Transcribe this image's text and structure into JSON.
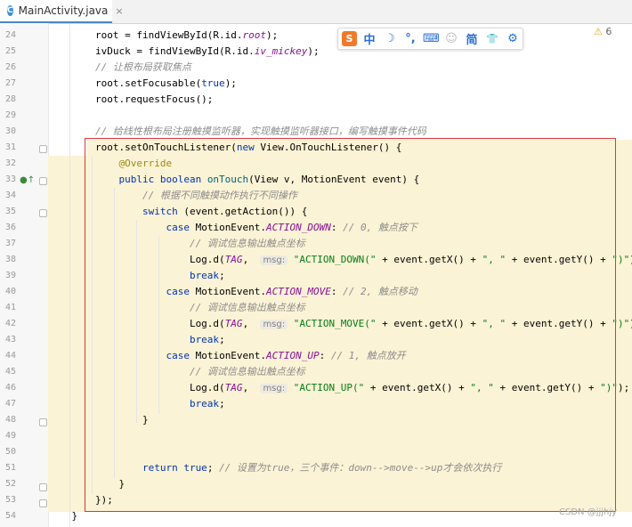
{
  "tab": {
    "icon": "C",
    "title": "MainActivity.java",
    "close": "×"
  },
  "warnings": {
    "icon": "warning-triangle-icon",
    "count": "6"
  },
  "ime_toolbar": {
    "logo": "S",
    "mode": "中",
    "items": [
      "☽",
      "°,",
      "⌨",
      "☺",
      "简",
      "👕",
      "⚙"
    ]
  },
  "lines": [
    {
      "n": "24",
      "segs": [
        [
          "",
          "        root = findViewById(R.id."
        ],
        [
          "field",
          "root"
        ],
        [
          "",
          ");"
        ]
      ]
    },
    {
      "n": "25",
      "segs": [
        [
          "",
          "        ivDuck = findViewById(R.id."
        ],
        [
          "field",
          "iv_mickey"
        ],
        [
          "",
          ");"
        ]
      ]
    },
    {
      "n": "26",
      "segs": [
        [
          "cm",
          "        // 让根布局获取焦点"
        ]
      ]
    },
    {
      "n": "27",
      "segs": [
        [
          "",
          "        root.setFocusable("
        ],
        [
          "kw",
          "true"
        ],
        [
          "",
          ");"
        ]
      ]
    },
    {
      "n": "28",
      "segs": [
        [
          "",
          "        root.requestFocus();"
        ]
      ]
    },
    {
      "n": "29",
      "segs": [
        [
          "",
          ""
        ]
      ]
    },
    {
      "n": "30",
      "segs": [
        [
          "cm",
          "        // 给线性根布局注册触摸监听器，实现触摸监听器接口，编写触摸事件代码"
        ]
      ]
    },
    {
      "n": "31",
      "segs": [
        [
          "",
          "        root.setOnTouchListener("
        ],
        [
          "kw",
          "new"
        ],
        [
          "",
          " View.OnTouchListener() {"
        ]
      ]
    },
    {
      "n": "32",
      "segs": [
        [
          "ann",
          "            @Override"
        ]
      ]
    },
    {
      "n": "33",
      "segs": [
        [
          "kw",
          "            public boolean "
        ],
        [
          "fn",
          "onTouch"
        ],
        [
          "",
          "(View v, MotionEvent event) {"
        ]
      ]
    },
    {
      "n": "34",
      "segs": [
        [
          "cm",
          "                // 根据不同触摸动作执行不同操作"
        ]
      ]
    },
    {
      "n": "35",
      "segs": [
        [
          "kw",
          "                switch"
        ],
        [
          "",
          " (event.getAction()) {"
        ]
      ]
    },
    {
      "n": "36",
      "segs": [
        [
          "kw",
          "                    case"
        ],
        [
          "",
          " MotionEvent."
        ],
        [
          "field",
          "ACTION_DOWN"
        ],
        [
          "",
          ": "
        ],
        [
          "cm",
          "// 0, 触点按下"
        ]
      ]
    },
    {
      "n": "37",
      "segs": [
        [
          "cm",
          "                        // 调试信息输出触点坐标"
        ]
      ]
    },
    {
      "n": "38",
      "segs": [
        [
          "",
          "                        Log.d("
        ],
        [
          "field",
          "TAG"
        ],
        [
          "",
          ",  "
        ],
        [
          "hint",
          "msg:"
        ],
        [
          "str",
          " \"ACTION_DOWN(\""
        ],
        [
          "",
          " + event.getX() + "
        ],
        [
          "str",
          "\", \""
        ],
        [
          "",
          " + event.getY() + "
        ],
        [
          "str",
          "\")\""
        ],
        [
          "",
          ");"
        ]
      ]
    },
    {
      "n": "39",
      "segs": [
        [
          "kw",
          "                        break"
        ],
        [
          "",
          ";"
        ]
      ]
    },
    {
      "n": "40",
      "segs": [
        [
          "kw",
          "                    case"
        ],
        [
          "",
          " MotionEvent."
        ],
        [
          "field",
          "ACTION_MOVE"
        ],
        [
          "",
          ": "
        ],
        [
          "cm",
          "// 2, 触点移动"
        ]
      ]
    },
    {
      "n": "41",
      "segs": [
        [
          "cm",
          "                        // 调试信息输出触点坐标"
        ]
      ]
    },
    {
      "n": "42",
      "segs": [
        [
          "",
          "                        Log.d("
        ],
        [
          "field",
          "TAG"
        ],
        [
          "",
          ",  "
        ],
        [
          "hint",
          "msg:"
        ],
        [
          "str",
          " \"ACTION_MOVE(\""
        ],
        [
          "",
          " + event.getX() + "
        ],
        [
          "str",
          "\", \""
        ],
        [
          "",
          " + event.getY() + "
        ],
        [
          "str",
          "\")\""
        ],
        [
          "",
          ");"
        ]
      ]
    },
    {
      "n": "43",
      "segs": [
        [
          "kw",
          "                        break"
        ],
        [
          "",
          ";"
        ]
      ]
    },
    {
      "n": "44",
      "segs": [
        [
          "kw",
          "                    case"
        ],
        [
          "",
          " MotionEvent."
        ],
        [
          "field",
          "ACTION_UP"
        ],
        [
          "",
          ": "
        ],
        [
          "cm",
          "// 1, 触点放开"
        ]
      ]
    },
    {
      "n": "45",
      "segs": [
        [
          "cm",
          "                        // 调试信息输出触点坐标"
        ]
      ]
    },
    {
      "n": "46",
      "segs": [
        [
          "",
          "                        Log.d("
        ],
        [
          "field",
          "TAG"
        ],
        [
          "",
          ",  "
        ],
        [
          "hint",
          "msg:"
        ],
        [
          "str",
          " \"ACTION_UP(\""
        ],
        [
          "",
          " + event.getX() + "
        ],
        [
          "str",
          "\", \""
        ],
        [
          "",
          " + event.getY() + "
        ],
        [
          "str",
          "\")\""
        ],
        [
          "",
          ");"
        ]
      ]
    },
    {
      "n": "47",
      "segs": [
        [
          "kw",
          "                        break"
        ],
        [
          "",
          ";"
        ]
      ]
    },
    {
      "n": "48",
      "segs": [
        [
          "",
          "                }"
        ]
      ]
    },
    {
      "n": "49",
      "segs": [
        [
          "",
          ""
        ]
      ]
    },
    {
      "n": "50",
      "segs": [
        [
          "",
          ""
        ]
      ]
    },
    {
      "n": "51",
      "segs": [
        [
          "kw",
          "                return true"
        ],
        [
          "",
          "; "
        ],
        [
          "cm",
          "// 设置为true，三个事件：down-->move-->up才会依次执行"
        ]
      ]
    },
    {
      "n": "52",
      "segs": [
        [
          "",
          "            }"
        ]
      ]
    },
    {
      "n": "53",
      "segs": [
        [
          "",
          "        });"
        ]
      ]
    },
    {
      "n": "54",
      "segs": [
        [
          "",
          "    }"
        ]
      ]
    }
  ],
  "watermark": "CSDN @jjjhjy"
}
